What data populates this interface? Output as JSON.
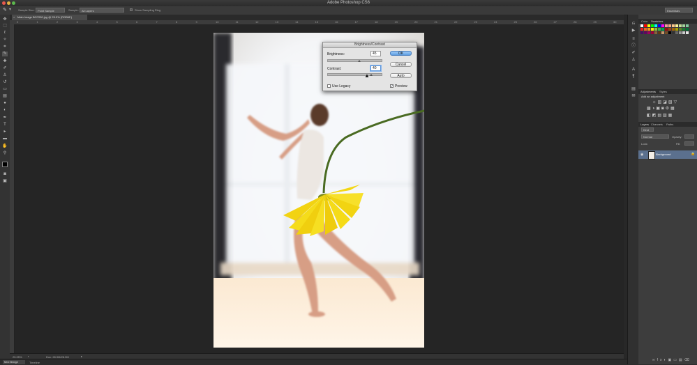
{
  "window": {
    "title": "Adobe Photoshop CS6"
  },
  "options_bar": {
    "sample_size_label": "Sample Size:",
    "sample_size_value": "Point Sample",
    "sample_label": "Sample:",
    "sample_value": "All Layers",
    "show_ring_label": "Show Sampling Ring",
    "workspace": "Essentials"
  },
  "document": {
    "tab_label": "Main Image BO7050.jpg @ 25.9% (RGB/8*)"
  },
  "ruler_top_ticks": [
    "0",
    "1",
    "2",
    "3",
    "4",
    "5",
    "6",
    "7",
    "8",
    "9",
    "10",
    "11",
    "12",
    "13",
    "14",
    "15",
    "16",
    "17",
    "18",
    "19",
    "20",
    "21",
    "22",
    "23",
    "24",
    "25",
    "26",
    "27",
    "28",
    "29",
    "30"
  ],
  "status": {
    "zoom": "25.95%",
    "doc_info": "Doc: 28.9M/28.9M"
  },
  "bottom": {
    "tab1": "Mini Bridge",
    "tab2": "Timeline"
  },
  "panels": {
    "color_tabs": [
      "Color",
      "Swatches"
    ],
    "adjust_tabs": [
      "Adjustments",
      "Styles"
    ],
    "add_adjustment": "Add an adjustment",
    "layers_tabs": [
      "Layers",
      "Channels",
      "Paths"
    ],
    "kind_label": "Kind",
    "blend_mode": "Normal",
    "opacity_label": "Opacity:",
    "lock_label": "Lock:",
    "fill_label": "Fill:",
    "layer_name": "Background"
  },
  "swatch_colors": [
    "#ffffff",
    "#ff0000",
    "#ffff00",
    "#00ff00",
    "#00ffff",
    "#0000ff",
    "#ff00ff",
    "#f6989d",
    "#f9ad81",
    "#fdc68a",
    "#fff79a",
    "#c4df9b",
    "#a3d39c",
    "#82ca9d",
    "#ed1c24",
    "#f26522",
    "#f7941d",
    "#fff200",
    "#8dc63f",
    "#39b54a",
    "#00a651",
    "#9e0b0f",
    "#a0410d",
    "#a36209",
    "#aba000",
    "#598527",
    "#1a7b30",
    "#007236",
    "#440e62",
    "#630460",
    "#9e005d",
    "#9e0039",
    "#8c6239",
    "#603913",
    "#c69c6d",
    "#754c24",
    "#000000",
    "#333333",
    "#666666",
    "#999999",
    "#cccccc",
    "#e6e6e6"
  ],
  "dialog": {
    "title": "Brightness/Contrast",
    "brightness_label": "Brightness:",
    "brightness_value": "45",
    "contrast_label": "Contrast:",
    "contrast_value": "40",
    "ok": "OK",
    "cancel": "Cancel",
    "auto": "Auto",
    "use_legacy": "Use Legacy",
    "preview": "Preview",
    "brightness_slider_level": 0.6,
    "contrast_slider_level": 0.82
  }
}
